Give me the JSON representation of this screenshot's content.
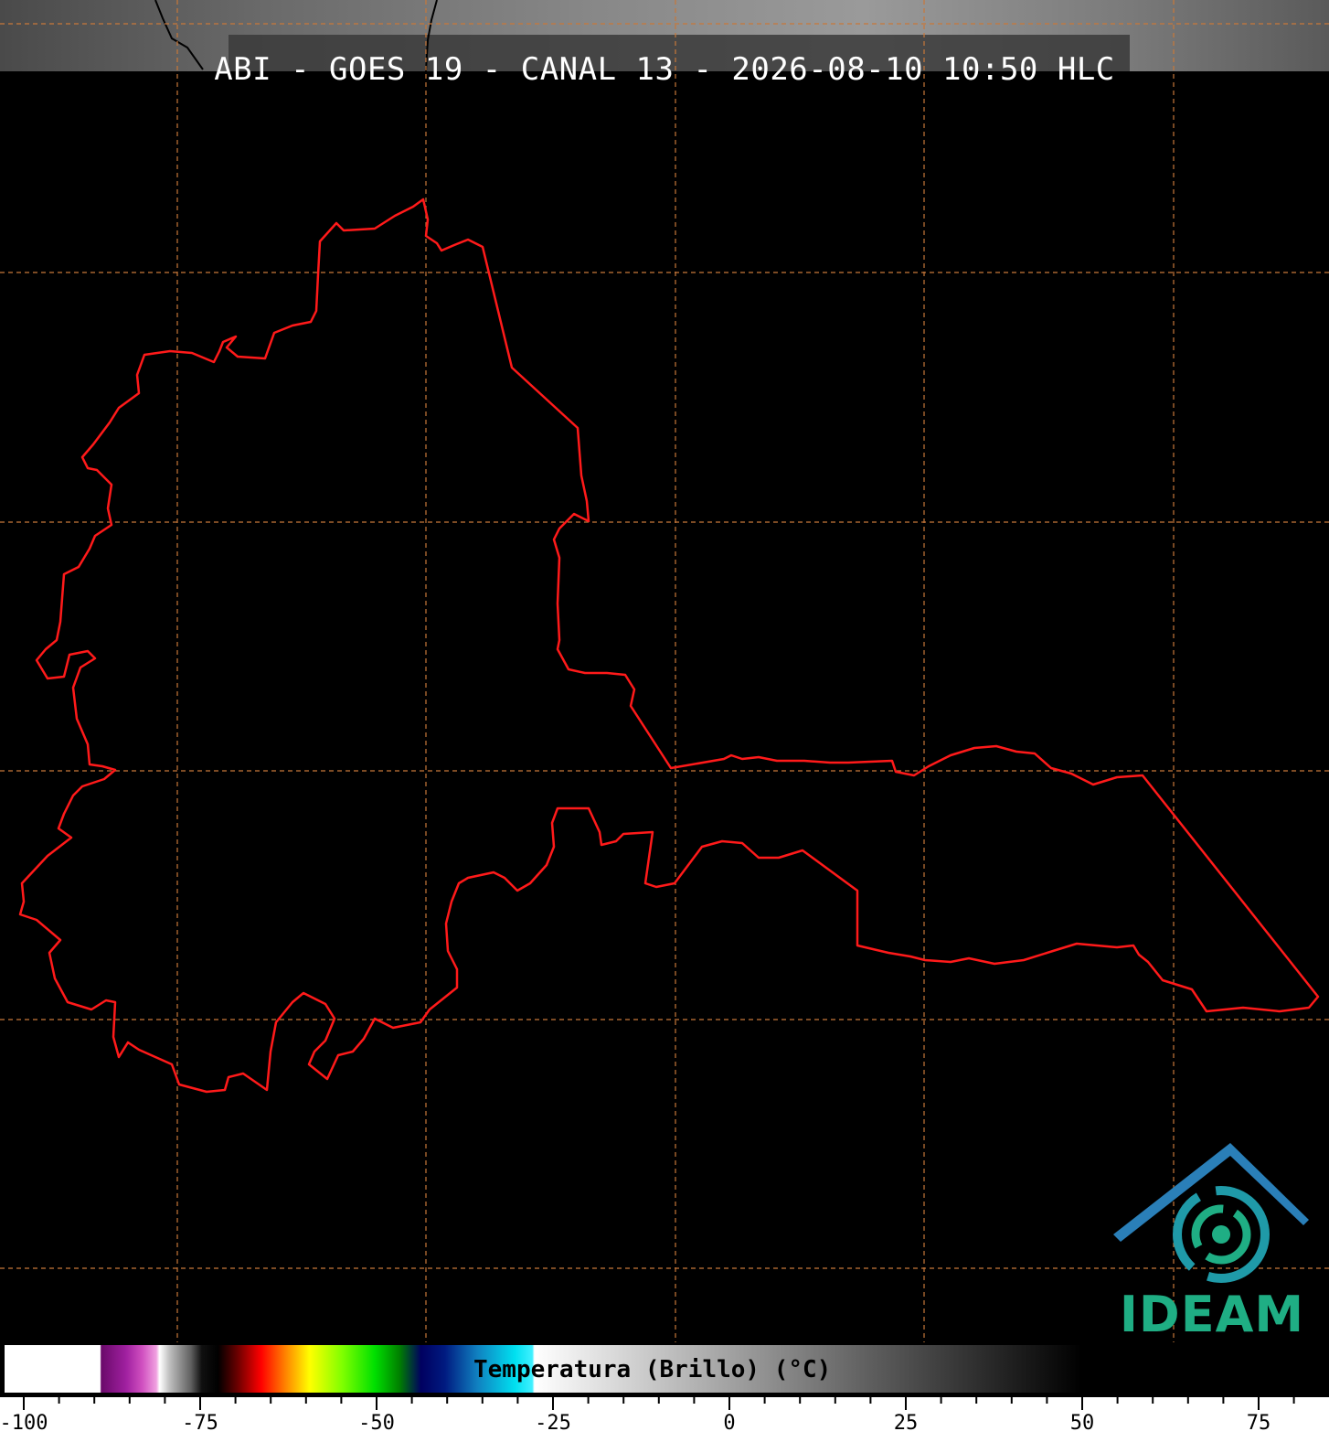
{
  "title": "ABI - GOES 19 - CANAL 13 - 2026-08-10 10:50 HLC",
  "logo": {
    "text": "IDEAM",
    "color": "#1fae84",
    "arc_color": "#2a7fb8"
  },
  "colorbar": {
    "label": "Temperatura (Brillo) (°C)",
    "min": -105,
    "max": 85,
    "ticks_major": [
      {
        "value": -100,
        "label": "-100"
      },
      {
        "value": -75,
        "label": "-75"
      },
      {
        "value": -50,
        "label": "-50"
      },
      {
        "value": -25,
        "label": "-25"
      },
      {
        "value": 0,
        "label": "0"
      },
      {
        "value": 25,
        "label": "25"
      },
      {
        "value": 50,
        "label": "50"
      },
      {
        "value": 75,
        "label": "75"
      }
    ],
    "minor_step": 5
  },
  "colors": {
    "background": "#000000",
    "outline": "#ff1a1a",
    "grid": "#c8783a",
    "cloud_band": "#707070"
  }
}
